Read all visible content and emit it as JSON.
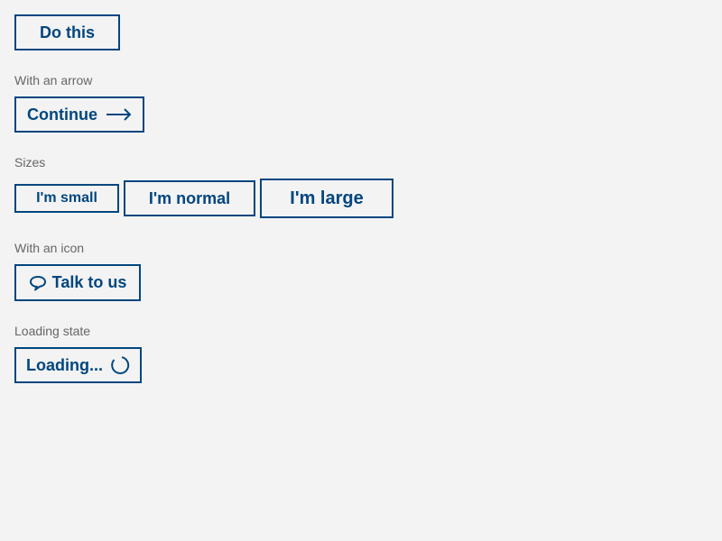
{
  "buttons": {
    "primary": {
      "label": "Do this"
    },
    "arrow_section_label": "With an arrow",
    "arrow": {
      "label": "Continue",
      "icon": "arrow-right-icon"
    },
    "sizes_section_label": "Sizes",
    "small": {
      "label": "I'm small"
    },
    "normal": {
      "label": "I'm normal"
    },
    "large": {
      "label": "I'm large"
    },
    "icon_section_label": "With an icon",
    "icon_button": {
      "label": "Talk to us",
      "icon": "speech-bubble-icon"
    },
    "loading_section_label": "Loading state",
    "loading": {
      "label": "Loading...",
      "icon": "spinner-icon"
    }
  },
  "colors": {
    "accent": "#00467f",
    "label": "#666666",
    "background": "#f3f3f3"
  }
}
